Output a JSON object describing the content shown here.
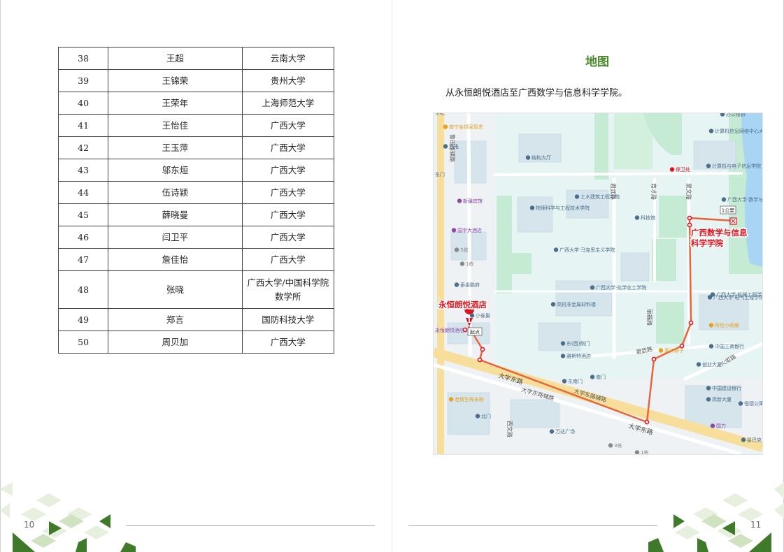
{
  "table": {
    "rows": [
      {
        "num": "38",
        "name": "王超",
        "affiliation": "云南大学"
      },
      {
        "num": "39",
        "name": "王锦荣",
        "affiliation": "贵州大学"
      },
      {
        "num": "40",
        "name": "王荣年",
        "affiliation": "上海师范大学"
      },
      {
        "num": "41",
        "name": "王怡佳",
        "affiliation": "广西大学"
      },
      {
        "num": "42",
        "name": "王玉萍",
        "affiliation": "广西大学"
      },
      {
        "num": "43",
        "name": "邬东烜",
        "affiliation": "广西大学"
      },
      {
        "num": "44",
        "name": "伍诗颖",
        "affiliation": "广西大学"
      },
      {
        "num": "45",
        "name": "薛晓曼",
        "affiliation": "广西大学"
      },
      {
        "num": "46",
        "name": "闫卫平",
        "affiliation": "广西大学"
      },
      {
        "num": "47",
        "name": "詹佳怡",
        "affiliation": "广西大学"
      },
      {
        "num": "48",
        "name": "张晓",
        "affiliation": "广西大学/中国科学院数学所"
      },
      {
        "num": "49",
        "name": "郑言",
        "affiliation": "国防科技大学"
      },
      {
        "num": "50",
        "name": "周贝加",
        "affiliation": "广西大学"
      }
    ]
  },
  "map_section": {
    "title": "地图",
    "description": "从永恒朗悦酒店至广西数学与信息科学学院。"
  },
  "map": {
    "origin_label": "永恒朗悦酒店",
    "origin_marker": "1",
    "origin_small_label": "永恒朗悦酒店",
    "origin_tag": "起点",
    "dest_label_line1": "广西数学与信息",
    "dest_label_line2": "科学学院",
    "dest_tag": "1公里",
    "road_daxue_1": "大学东路",
    "road_daxue_2": "大学东路辅路",
    "road_daxue_3": "大学东路",
    "road_lurun": "鲁班路辅路",
    "road_junwu": "君武路",
    "road_yucai": "育才路",
    "road_jingwen": "景文路",
    "road_lifu": "丽福路",
    "road_xiwen": "西文路",
    "road_huofang": "火炬路",
    "pois": [
      "南宁金拱家厨艺",
      "汽电",
      "东门",
      "结构大厅",
      "新疆宾馆",
      "国宇大酒店",
      "物理科学与工程技术学院",
      "土木建筑工程学院",
      "科技馆",
      "广西大学·马克思主义学院",
      "广西大学·化学化工学院",
      "高机非金属材料楼",
      "泰金鹏府",
      "小雀巢",
      "东(西)侧门",
      "雅斯特酒店",
      "南门",
      "东南门",
      "老情生榨米粉",
      "北门",
      "万达广场",
      "计算机信息网络中心大楼",
      "计算机与电子信息学院",
      "保卫处",
      "广西大学·数学与信息学院",
      "广西大学·电气工程学院",
      "广西大学·机械工程学院",
      "阿伦小雨餐",
      "重庆寨子",
      "中国工商银行",
      "创业大厦",
      "中国建设银行",
      "高新大厦",
      "恒德公寓",
      "国力",
      "星巴克",
      "办公楼群",
      "世纪",
      "5栋",
      "1栋",
      "3栋",
      "1栋"
    ]
  },
  "footer": {
    "left_page_number": "10",
    "right_page_number": "11"
  },
  "colors": {
    "accent_green": "#4a8a2c",
    "route": "#e8643c",
    "label_red": "#e0141e",
    "deco_dark": "#3f7a2a",
    "deco_light": "#dce9cf"
  }
}
